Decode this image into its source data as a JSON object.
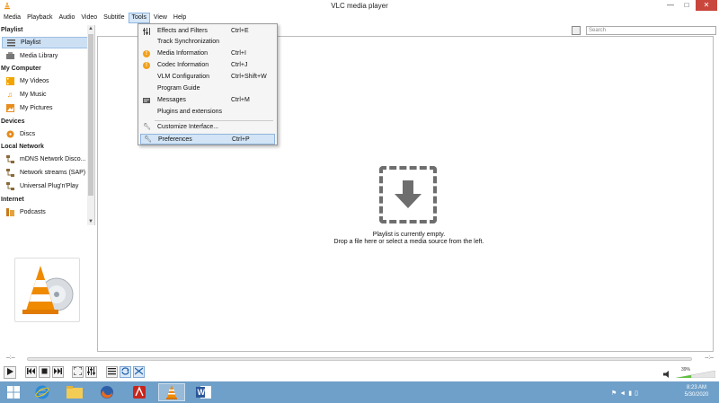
{
  "window": {
    "title": "VLC media player",
    "controls": [
      "—",
      "□",
      "✕"
    ]
  },
  "menubar": {
    "items": [
      "Media",
      "Playback",
      "Audio",
      "Video",
      "Subtitle",
      "Tools",
      "View",
      "Help"
    ],
    "active": "Tools"
  },
  "tools_menu": {
    "items": [
      {
        "label": "Effects and Filters",
        "shortcut": "Ctrl+E",
        "icon": "sliders-icon"
      },
      {
        "label": "Track Synchronization",
        "shortcut": "",
        "icon": ""
      },
      {
        "label": "Media Information",
        "shortcut": "Ctrl+I",
        "icon": "info-warning-icon"
      },
      {
        "label": "Codec Information",
        "shortcut": "Ctrl+J",
        "icon": "info-warning-icon"
      },
      {
        "label": "VLM Configuration",
        "shortcut": "Ctrl+Shift+W",
        "icon": ""
      },
      {
        "label": "Program Guide",
        "shortcut": "",
        "icon": ""
      },
      {
        "label": "Messages",
        "shortcut": "Ctrl+M",
        "icon": "messages-icon"
      },
      {
        "label": "Plugins and extensions",
        "shortcut": "",
        "icon": ""
      },
      {
        "label": "Customize Interface...",
        "shortcut": "",
        "icon": "wrench-icon"
      },
      {
        "label": "Preferences",
        "shortcut": "Ctrl+P",
        "icon": "wrench-icon"
      }
    ],
    "highlighted": "Preferences"
  },
  "sidebar": {
    "sections": {
      "playlist": "Playlist",
      "my_computer": "My Computer",
      "devices": "Devices",
      "local_network": "Local Network",
      "internet": "Internet"
    },
    "items": {
      "playlist": "Playlist",
      "media_library": "Media Library",
      "my_videos": "My Videos",
      "my_music": "My Music",
      "my_pictures": "My Pictures",
      "discs": "Discs",
      "mdns": "mDNS Network Disco...",
      "network_streams": "Network streams (SAP)",
      "upnp": "Universal Plug'n'Play",
      "podcasts": "Podcasts"
    },
    "selected": "Playlist"
  },
  "playlist_area": {
    "search_placeholder": "Search",
    "empty_line1": "Playlist is currently empty.",
    "empty_line2": "Drop a file here or select a media source from the left."
  },
  "player": {
    "time_elapsed": "--:--",
    "time_total": "--:--",
    "volume_percent": "39%",
    "volume_level": 0.39
  },
  "taskbar": {
    "time": "8:23 AM",
    "date": "5/30/2020"
  },
  "colors": {
    "vlc_orange": "#f08a00",
    "taskbar_blue": "#6fa0c9",
    "menu_highlight": "#d2e4f5",
    "close_red": "#c9463d"
  }
}
